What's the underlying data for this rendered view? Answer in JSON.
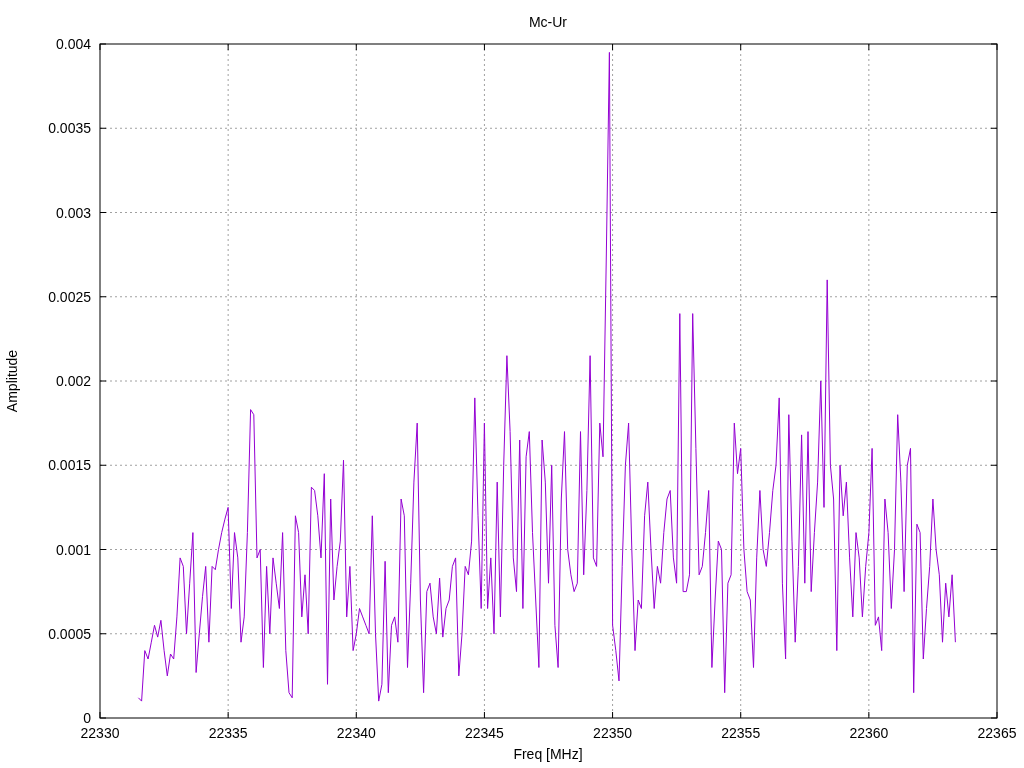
{
  "chart_data": {
    "type": "line",
    "grid": true,
    "title": "Mc-Ur",
    "xlabel": "Freq [MHz]",
    "ylabel": "Amplitude",
    "xlim": [
      22330,
      22365
    ],
    "ylim": [
      0,
      0.004
    ],
    "xticks": [
      22330,
      22335,
      22340,
      22345,
      22350,
      22355,
      22360,
      22365
    ],
    "yticks": [
      {
        "value": 0,
        "label": "0"
      },
      {
        "value": 0.0005,
        "label": "0.0005"
      },
      {
        "value": 0.001,
        "label": "0.001"
      },
      {
        "value": 0.0015,
        "label": "0.0015"
      },
      {
        "value": 0.002,
        "label": "0.002"
      },
      {
        "value": 0.0025,
        "label": "0.0025"
      },
      {
        "value": 0.003,
        "label": "0.003"
      },
      {
        "value": 0.0035,
        "label": "0.0035"
      },
      {
        "value": 0.004,
        "label": "0.004"
      }
    ],
    "x": [
      22331.5,
      22331.625,
      22331.75,
      22331.875,
      22332,
      22332.125,
      22332.25,
      22332.375,
      22332.5,
      22332.625,
      22332.75,
      22332.875,
      22333,
      22333.125,
      22333.25,
      22333.375,
      22333.5,
      22333.625,
      22333.75,
      22333.875,
      22334,
      22334.125,
      22334.25,
      22334.375,
      22334.5,
      22334.625,
      22334.75,
      22334.875,
      22335,
      22335.125,
      22335.25,
      22335.375,
      22335.5,
      22335.625,
      22335.75,
      22335.875,
      22336,
      22336.125,
      22336.25,
      22336.375,
      22336.5,
      22336.625,
      22336.75,
      22336.875,
      22337,
      22337.125,
      22337.25,
      22337.375,
      22337.5,
      22337.625,
      22337.75,
      22337.875,
      22338,
      22338.125,
      22338.25,
      22338.375,
      22338.5,
      22338.625,
      22338.75,
      22338.875,
      22339,
      22339.125,
      22339.25,
      22339.375,
      22339.5,
      22339.625,
      22339.75,
      22339.875,
      22340,
      22340.125,
      22340.25,
      22340.375,
      22340.5,
      22340.625,
      22340.75,
      22340.875,
      22341,
      22341.125,
      22341.25,
      22341.375,
      22341.5,
      22341.625,
      22341.75,
      22341.875,
      22342,
      22342.125,
      22342.25,
      22342.375,
      22342.5,
      22342.625,
      22342.75,
      22342.875,
      22343,
      22343.125,
      22343.25,
      22343.375,
      22343.5,
      22343.625,
      22343.75,
      22343.875,
      22344,
      22344.125,
      22344.25,
      22344.375,
      22344.5,
      22344.625,
      22344.75,
      22344.875,
      22345,
      22345.125,
      22345.25,
      22345.375,
      22345.5,
      22345.625,
      22345.75,
      22345.875,
      22346,
      22346.125,
      22346.25,
      22346.375,
      22346.5,
      22346.625,
      22346.75,
      22346.875,
      22347,
      22347.125,
      22347.25,
      22347.375,
      22347.5,
      22347.625,
      22347.75,
      22347.875,
      22348,
      22348.125,
      22348.25,
      22348.375,
      22348.5,
      22348.625,
      22348.75,
      22348.875,
      22349,
      22349.125,
      22349.25,
      22349.375,
      22349.5,
      22349.625,
      22349.75,
      22349.875,
      22350,
      22350.125,
      22350.25,
      22350.375,
      22350.5,
      22350.625,
      22350.75,
      22350.875,
      22351,
      22351.125,
      22351.25,
      22351.375,
      22351.5,
      22351.625,
      22351.75,
      22351.875,
      22352,
      22352.125,
      22352.25,
      22352.375,
      22352.5,
      22352.625,
      22352.75,
      22352.875,
      22353,
      22353.125,
      22353.25,
      22353.375,
      22353.5,
      22353.625,
      22353.75,
      22353.875,
      22354,
      22354.125,
      22354.25,
      22354.375,
      22354.5,
      22354.625,
      22354.75,
      22354.875,
      22355,
      22355.125,
      22355.25,
      22355.375,
      22355.5,
      22355.625,
      22355.75,
      22355.875,
      22356,
      22356.125,
      22356.25,
      22356.375,
      22356.5,
      22356.625,
      22356.75,
      22356.875,
      22357,
      22357.125,
      22357.25,
      22357.375,
      22357.5,
      22357.625,
      22357.75,
      22357.875,
      22358,
      22358.125,
      22358.25,
      22358.375,
      22358.5,
      22358.625,
      22358.75,
      22358.875,
      22359,
      22359.125,
      22359.25,
      22359.375,
      22359.5,
      22359.625,
      22359.75,
      22359.875,
      22360,
      22360.125,
      22360.25,
      22360.375,
      22360.5,
      22360.625,
      22360.75,
      22360.875,
      22361,
      22361.125,
      22361.25,
      22361.375,
      22361.5,
      22361.625,
      22361.75,
      22361.875,
      22362,
      22362.125,
      22362.25,
      22362.375,
      22362.5,
      22362.625,
      22362.75,
      22362.875,
      22363,
      22363.125,
      22363.25,
      22363.375
    ],
    "series": [
      {
        "color": "#9400d3",
        "values": [
          0.00012,
          0.0001,
          0.0004,
          0.00035,
          0.00045,
          0.00055,
          0.00048,
          0.00058,
          0.0004,
          0.00025,
          0.00038,
          0.00035,
          0.0006,
          0.00095,
          0.0009,
          0.0005,
          0.0008,
          0.0011,
          0.00027,
          0.0005,
          0.00072,
          0.0009,
          0.00045,
          0.0009,
          0.00088,
          0.001,
          0.0011,
          0.00118,
          0.00125,
          0.00065,
          0.0011,
          0.00095,
          0.00045,
          0.0006,
          0.0011,
          0.00183,
          0.0018,
          0.00095,
          0.001,
          0.0003,
          0.0009,
          0.0005,
          0.00095,
          0.0008,
          0.00065,
          0.0011,
          0.0004,
          0.00015,
          0.00012,
          0.0012,
          0.0011,
          0.0006,
          0.00085,
          0.0005,
          0.00137,
          0.00135,
          0.0012,
          0.00095,
          0.00145,
          0.0002,
          0.0013,
          0.0007,
          0.0009,
          0.00105,
          0.00153,
          0.0006,
          0.0009,
          0.0004,
          0.0005,
          0.00065,
          0.0006,
          0.00055,
          0.0005,
          0.0012,
          0.0005,
          0.0001,
          0.0002,
          0.00093,
          0.00015,
          0.00055,
          0.0006,
          0.00045,
          0.0013,
          0.0012,
          0.0003,
          0.0008,
          0.0014,
          0.00175,
          0.0007,
          0.00015,
          0.00075,
          0.0008,
          0.0006,
          0.0005,
          0.00083,
          0.00048,
          0.00065,
          0.0007,
          0.0009,
          0.00095,
          0.00025,
          0.0005,
          0.0009,
          0.00085,
          0.00105,
          0.0019,
          0.0012,
          0.00065,
          0.00175,
          0.00065,
          0.00095,
          0.0005,
          0.0014,
          0.0006,
          0.0015,
          0.00215,
          0.0017,
          0.00095,
          0.00075,
          0.00165,
          0.00065,
          0.00155,
          0.0017,
          0.0011,
          0.0007,
          0.0003,
          0.00165,
          0.0014,
          0.0008,
          0.0015,
          0.00055,
          0.0003,
          0.0013,
          0.0017,
          0.001,
          0.00085,
          0.00075,
          0.0008,
          0.0017,
          0.00085,
          0.00135,
          0.00215,
          0.00095,
          0.0009,
          0.00175,
          0.00155,
          0.0027,
          0.00395,
          0.00055,
          0.0004,
          0.00022,
          0.0009,
          0.0015,
          0.00175,
          0.001,
          0.0004,
          0.0007,
          0.00065,
          0.0012,
          0.0014,
          0.001,
          0.00065,
          0.0009,
          0.0008,
          0.0011,
          0.0013,
          0.00135,
          0.00095,
          0.0008,
          0.0024,
          0.00075,
          0.00075,
          0.00085,
          0.0024,
          0.0016,
          0.00085,
          0.0009,
          0.0011,
          0.00135,
          0.0003,
          0.0007,
          0.00105,
          0.001,
          0.00015,
          0.0008,
          0.00085,
          0.00175,
          0.00145,
          0.0016,
          0.001,
          0.00075,
          0.0007,
          0.0003,
          0.00095,
          0.00135,
          0.001,
          0.0009,
          0.0011,
          0.00135,
          0.0015,
          0.0019,
          0.0008,
          0.00035,
          0.0018,
          0.00105,
          0.00045,
          0.0009,
          0.00168,
          0.0008,
          0.0017,
          0.00075,
          0.0011,
          0.0014,
          0.002,
          0.00125,
          0.0026,
          0.0015,
          0.0013,
          0.0004,
          0.0015,
          0.0012,
          0.0014,
          0.00095,
          0.0006,
          0.0011,
          0.00095,
          0.0006,
          0.0009,
          0.0011,
          0.0016,
          0.00055,
          0.0006,
          0.0004,
          0.0013,
          0.0011,
          0.00065,
          0.001,
          0.0018,
          0.0014,
          0.00075,
          0.0015,
          0.0016,
          0.00015,
          0.00115,
          0.0011,
          0.00035,
          0.00065,
          0.0009,
          0.0013,
          0.001,
          0.00085,
          0.00045,
          0.0008,
          0.0006,
          0.00085,
          0.00045
        ]
      }
    ]
  }
}
